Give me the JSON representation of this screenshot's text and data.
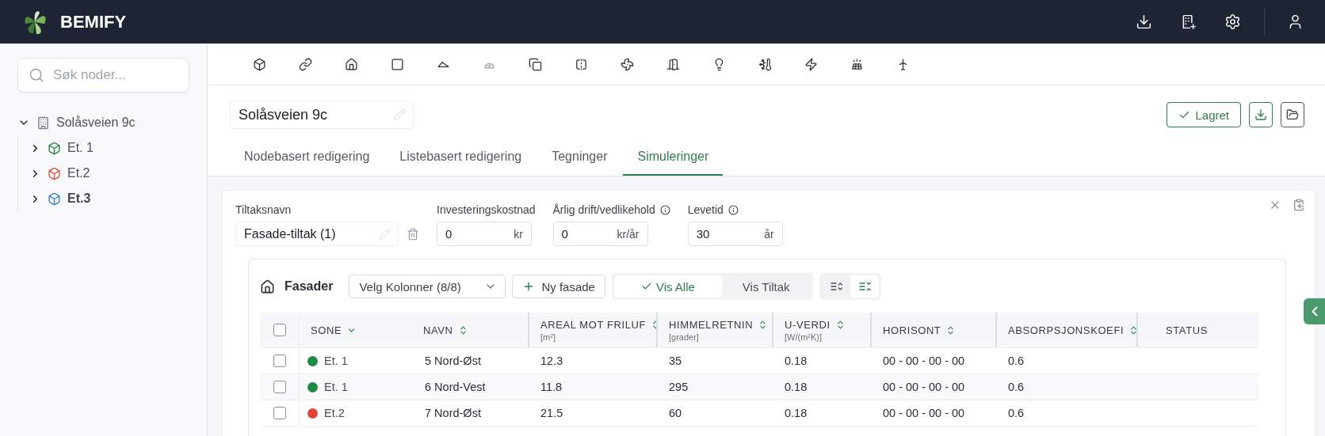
{
  "app": {
    "name": "BEMIFY"
  },
  "header_actions": [
    {
      "kind": "download"
    },
    {
      "kind": "building-add"
    },
    {
      "kind": "settings"
    },
    {
      "kind": "user"
    }
  ],
  "sidebar": {
    "search": {
      "placeholder": "Søk noder..."
    },
    "tree": {
      "label": "Solåsveien 9c",
      "expanded": true,
      "children": [
        {
          "label": "Et. 1",
          "color": "#2b8a4b",
          "expanded": false,
          "selected": false
        },
        {
          "label": "Et.2",
          "color": "#e0523c",
          "expanded": false,
          "selected": false
        },
        {
          "label": "Et.3",
          "color": "#3b7fc4",
          "expanded": false,
          "selected": true
        }
      ]
    }
  },
  "toolbar": [
    {
      "kind": "cube",
      "disabled": false
    },
    {
      "kind": "link",
      "disabled": false
    },
    {
      "kind": "house",
      "disabled": false
    },
    {
      "kind": "square",
      "disabled": false
    },
    {
      "kind": "roof",
      "disabled": false
    },
    {
      "kind": "dome",
      "disabled": true
    },
    {
      "kind": "copy",
      "disabled": false
    },
    {
      "kind": "split",
      "disabled": false
    },
    {
      "kind": "fan",
      "disabled": false
    },
    {
      "kind": "door",
      "disabled": false
    },
    {
      "kind": "bulb",
      "disabled": false
    },
    {
      "kind": "thermo",
      "disabled": false
    },
    {
      "kind": "bolt",
      "disabled": false
    },
    {
      "kind": "solar",
      "disabled": false
    },
    {
      "kind": "turbine",
      "disabled": false
    }
  ],
  "project": {
    "name": "Solåsveien 9c",
    "save_button": "Lagret"
  },
  "tabs": [
    {
      "label": "Nodebasert redigering",
      "selected": false
    },
    {
      "label": "Listebasert redigering",
      "selected": false
    },
    {
      "label": "Tegninger",
      "selected": false
    },
    {
      "label": "Simuleringer",
      "selected": true
    }
  ],
  "measure": {
    "fields": [
      {
        "kind": "name",
        "label": "Tiltaksnavn",
        "value": "Fasade-tiltak (1)",
        "info": false
      },
      {
        "kind": "number",
        "label": "Investeringskostnad",
        "value": "0",
        "unit": "kr",
        "info": false
      },
      {
        "kind": "number",
        "label": "Årlig drift/vedlikehold",
        "value": "0",
        "unit": "kr/år",
        "info": true
      },
      {
        "kind": "number",
        "label": "Levetid",
        "value": "30",
        "unit": "år",
        "info": true
      }
    ]
  },
  "facades": {
    "title": "Fasader",
    "column_picker": "Velg Kolonner (8/8)",
    "add_button": "Ny fasade",
    "view_toggle": [
      {
        "label": "Vis Alle",
        "selected": true
      },
      {
        "label": "Vis Tiltak",
        "selected": false
      }
    ],
    "density_toggle": [
      {
        "kind": "expand",
        "selected": false
      },
      {
        "kind": "collapse",
        "selected": true
      }
    ],
    "table": {
      "all_checked": false,
      "columns": [
        {
          "label": "SONE",
          "sortable": true,
          "sorted": true
        },
        {
          "label": "NAVN",
          "sortable": true,
          "sorted": false
        },
        {
          "label": "AREAL MOT FRILUF",
          "unit": "[m²]",
          "sortable": true,
          "sorted": false
        },
        {
          "label": "HIMMELRETNIN",
          "unit": "[grader]",
          "sortable": true,
          "sorted": false
        },
        {
          "label": "U-VERDI",
          "unit": "[W/(m²K)]",
          "sortable": true,
          "sorted": false
        },
        {
          "label": "HORISONT",
          "sortable": true,
          "sorted": false
        },
        {
          "label": "ABSORPSJONSKOEFI",
          "sortable": true,
          "sorted": false
        },
        {
          "label": "STATUS",
          "sortable": false
        }
      ],
      "rows": [
        {
          "checked": false,
          "color": "#1f8a45",
          "cells": [
            "Et. 1",
            "5 Nord-Øst",
            "12.3",
            "35",
            "0.18",
            "00 - 00 - 00 - 00",
            "0.6"
          ]
        },
        {
          "checked": false,
          "color": "#1f8a45",
          "cells": [
            "Et. 1",
            "6 Nord-Vest",
            "11.8",
            "295",
            "0.18",
            "00 - 00 - 00 - 00",
            "0.6"
          ]
        },
        {
          "checked": false,
          "color": "#e0443a",
          "cells": [
            "Et.2",
            "7 Nord-Øst",
            "21.5",
            "60",
            "0.18",
            "00 - 00 - 00 - 00",
            "0.6"
          ]
        }
      ]
    }
  }
}
